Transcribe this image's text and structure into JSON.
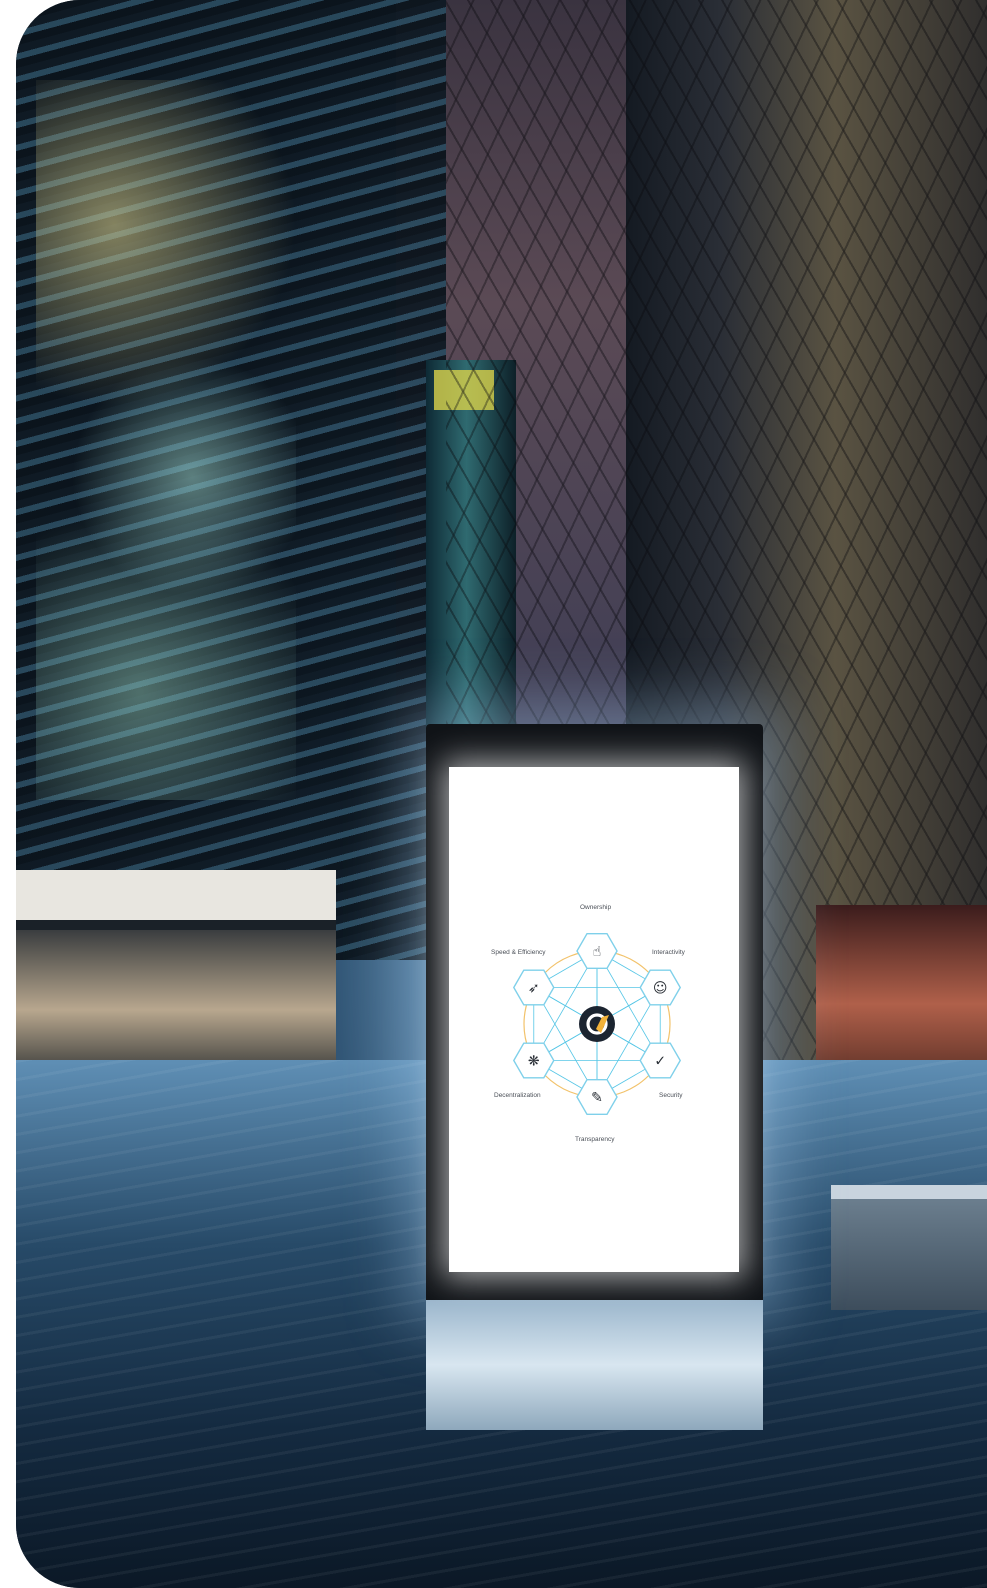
{
  "billboard": {
    "center_logo": "logo-icon",
    "features": [
      {
        "label": "Ownership",
        "icon": "fingerprint-icon"
      },
      {
        "label": "Interactivity",
        "icon": "person-icon"
      },
      {
        "label": "Security",
        "icon": "shield-check-icon"
      },
      {
        "label": "Transparency",
        "icon": "document-edit-icon"
      },
      {
        "label": "Decentralization",
        "icon": "network-icon"
      },
      {
        "label": "Speed & Efficiency",
        "icon": "rocket-icon"
      }
    ],
    "colors": {
      "hex_stroke": "#7fd0ea",
      "lines": "#56c6e6",
      "circle": "#f2c26a",
      "logo_bg": "#1b2430",
      "logo_accent": "#f2b23a"
    }
  }
}
